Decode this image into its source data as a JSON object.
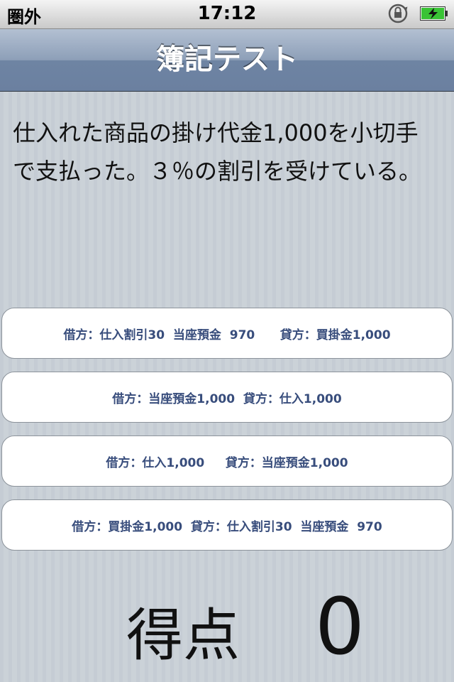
{
  "status_bar": {
    "carrier": "圏外",
    "time": "17:12",
    "icons": [
      "rotation-lock-icon",
      "battery-charging-icon"
    ],
    "battery_color": "#39c335"
  },
  "nav": {
    "title": "簿記テスト"
  },
  "question": "仕入れた商品の掛け代金1,000を小切手で支払った。３％の割引を受けている。",
  "answers": [
    {
      "label": "借方：仕入割引30  当座預金  970      貸方：買掛金1,000"
    },
    {
      "label": "借方：当座預金1,000  貸方：仕入1,000"
    },
    {
      "label": "借方：仕入1,000     貸方：当座預金1,000"
    },
    {
      "label": "借方：買掛金1,000  貸方：仕入割引30  当座預金  970"
    }
  ],
  "score": {
    "label": "得点",
    "value": "0"
  },
  "colors": {
    "answer_text": "#384d7c",
    "nav_bar": "#6e84a3"
  }
}
